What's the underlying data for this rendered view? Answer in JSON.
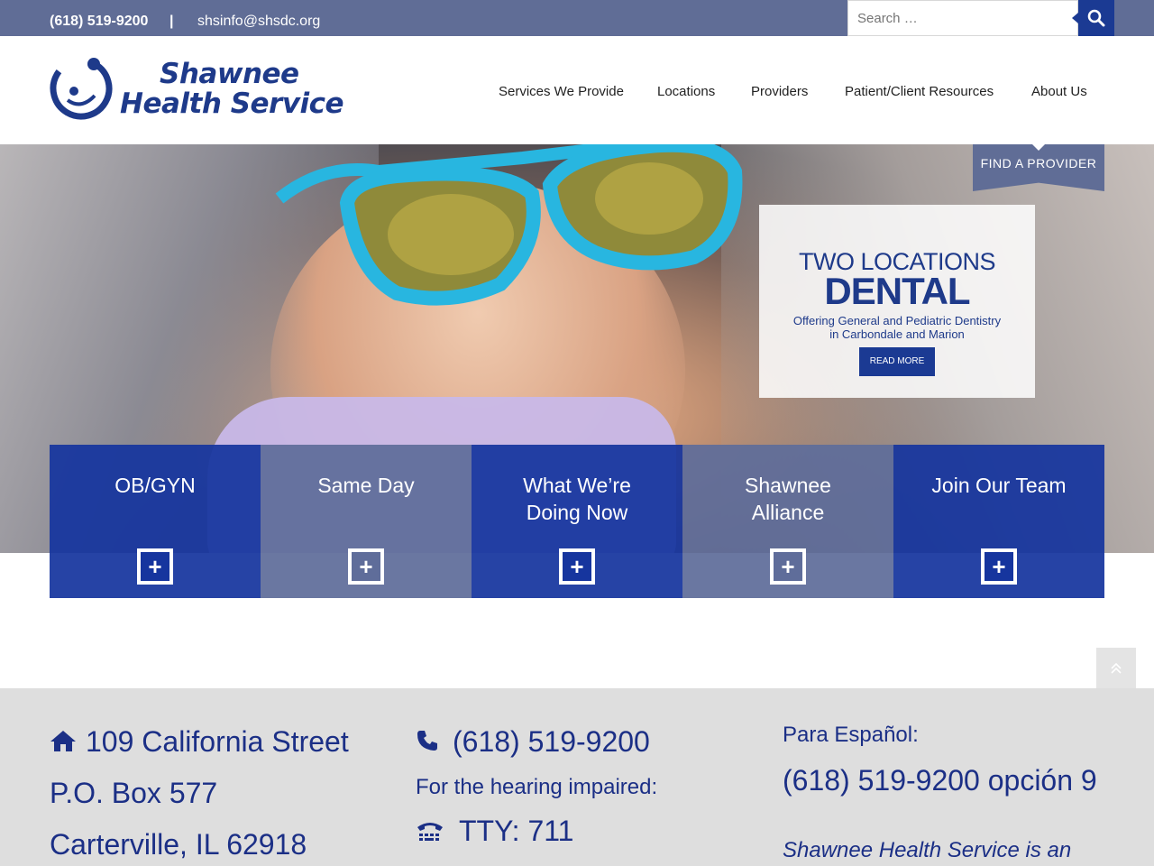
{
  "topbar": {
    "phone": "(618) 519-9200",
    "separator": "|",
    "email": "shsinfo@shsdc.org",
    "search_placeholder": "Search …"
  },
  "header": {
    "logo_line1": "Shawnee",
    "logo_line2": "Health Service",
    "nav": [
      "Services We Provide",
      "Locations",
      "Providers",
      "Patient/Client Resources",
      "About Us"
    ]
  },
  "hero": {
    "find_provider": "FIND A PROVIDER",
    "promo": {
      "line1": "TWO LOCATIONS",
      "line2": "DENTAL",
      "line3a": "Offering General and Pediatric Dentistry",
      "line3b": "in Carbondale and Marion",
      "button": "READ MORE"
    }
  },
  "tiles": [
    {
      "line1": "OB/GYN",
      "line2": ""
    },
    {
      "line1": "Same Day",
      "line2": ""
    },
    {
      "line1": "What We’re",
      "line2": "Doing Now"
    },
    {
      "line1": "Shawnee",
      "line2": "Alliance"
    },
    {
      "line1": "Join Our Team",
      "line2": ""
    }
  ],
  "footer": {
    "address": [
      "109 California Street",
      "P.O. Box 577",
      "Carterville, IL 62918"
    ],
    "phone": "(618) 519-9200",
    "hearing_label": "For the hearing impaired:",
    "tty": "TTY: 711",
    "spanish_label": "Para Español:",
    "spanish_phone": "(618) 519-9200 opción 9",
    "statement": "Shawnee Health Service is an"
  },
  "colors": {
    "topbar": "#606d96",
    "brand_blue": "#1b3a93",
    "tile_blue": "#16359e",
    "tile_gray": "#5f6d9a",
    "footer_bg": "#dedede",
    "footer_text": "#1b2f86"
  },
  "icons": [
    "search-icon",
    "home-icon",
    "phone-icon",
    "tty-icon",
    "plus-icon",
    "chevron-up-icon"
  ]
}
